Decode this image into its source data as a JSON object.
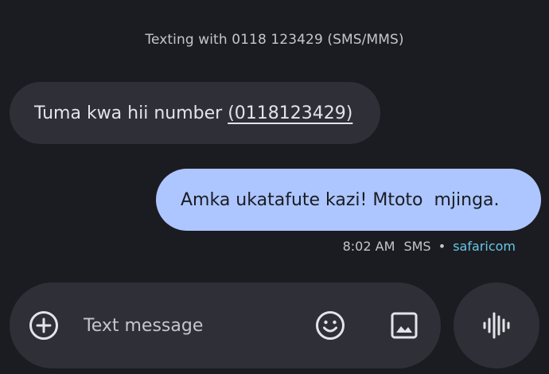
{
  "conversation": {
    "header": "Texting with 0118 123429 (SMS/MMS)"
  },
  "messages": [
    {
      "direction": "incoming",
      "text": "Tuma kwa hii number",
      "link": "(0118123429)"
    },
    {
      "direction": "outgoing",
      "text": "Amka ukatafute kazi! Mtoto  mjinga.",
      "time": "8:02 AM",
      "type": "SMS",
      "separator": "•",
      "carrier": "safaricom"
    }
  ],
  "composer": {
    "placeholder": "Text message",
    "add_icon": "plus-circle-icon",
    "emoji_icon": "smiley-icon",
    "gallery_icon": "image-icon",
    "voice_icon": "voice-waveform-icon"
  },
  "colors": {
    "background": "#1b1c21",
    "incoming_bubble": "#2f3037",
    "outgoing_bubble": "#adc6ff",
    "carrier_accent": "#67c6e7"
  }
}
